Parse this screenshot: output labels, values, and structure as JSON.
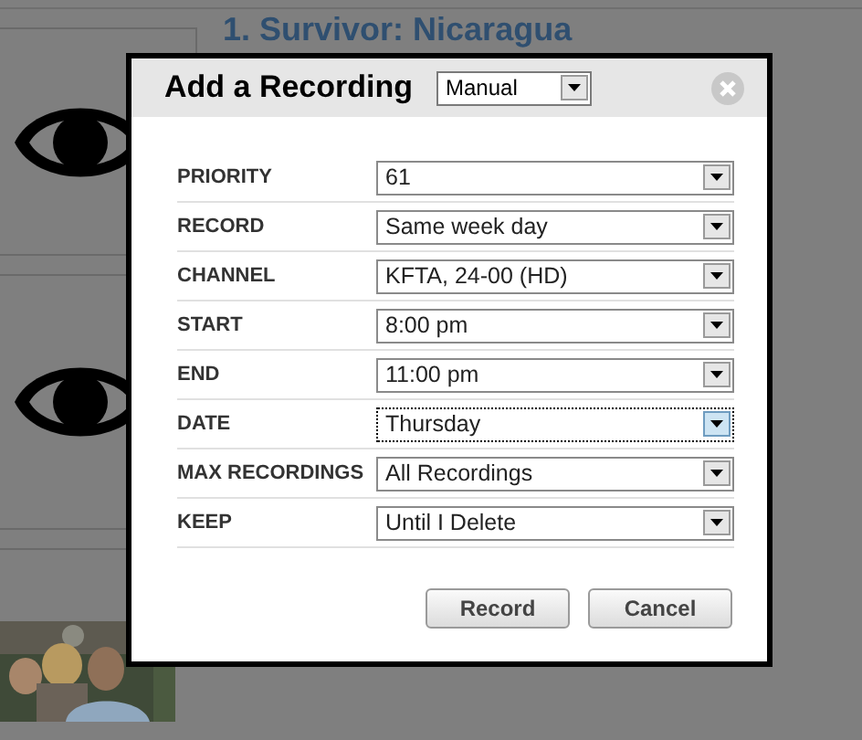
{
  "background": {
    "show_title": "1. Survivor: Nicaragua"
  },
  "dialog": {
    "title": "Add a Recording",
    "mode": "Manual",
    "fields": [
      {
        "label": "PRIORITY",
        "value": "61",
        "focused": false
      },
      {
        "label": "RECORD",
        "value": "Same week day",
        "focused": false
      },
      {
        "label": "CHANNEL",
        "value": "KFTA, 24-00 (HD)",
        "focused": false
      },
      {
        "label": "START",
        "value": "8:00 pm",
        "focused": false
      },
      {
        "label": "END",
        "value": "11:00 pm",
        "focused": false
      },
      {
        "label": "DATE",
        "value": "Thursday",
        "focused": true
      },
      {
        "label": "MAX RECORDINGS",
        "value": "All Recordings",
        "focused": false
      },
      {
        "label": "KEEP",
        "value": "Until I Delete",
        "focused": false
      }
    ],
    "buttons": [
      "Record",
      "Cancel"
    ]
  }
}
